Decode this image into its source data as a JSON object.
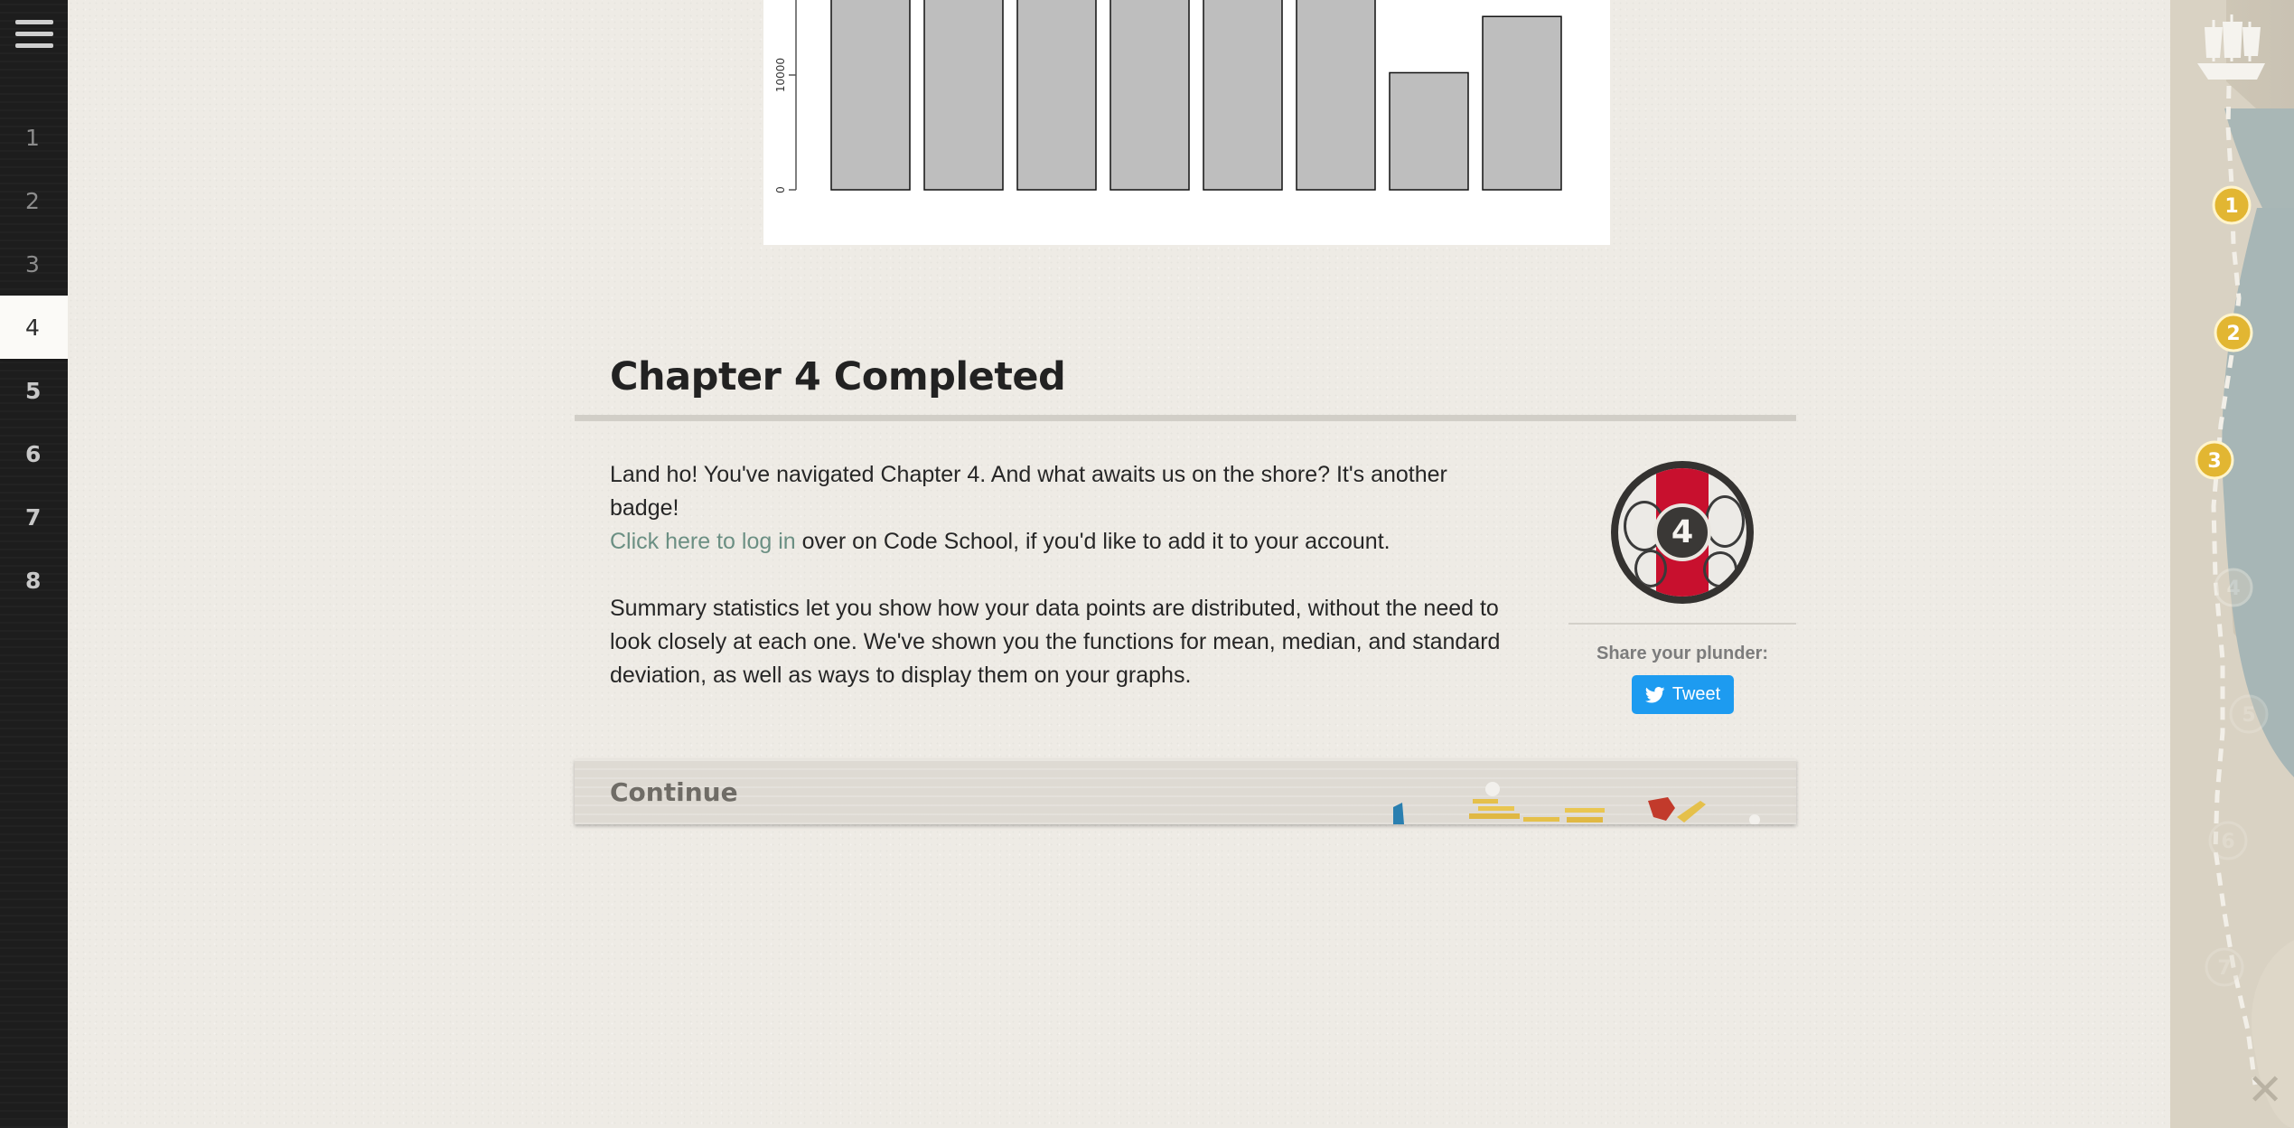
{
  "sidebar": {
    "chapters": [
      {
        "label": "1",
        "state": "done"
      },
      {
        "label": "2",
        "state": "done"
      },
      {
        "label": "3",
        "state": "done"
      },
      {
        "label": "4",
        "state": "active"
      },
      {
        "label": "5",
        "state": "upcoming"
      },
      {
        "label": "6",
        "state": "upcoming"
      },
      {
        "label": "7",
        "state": "upcoming"
      },
      {
        "label": "8",
        "state": "upcoming"
      }
    ]
  },
  "chart_data": {
    "type": "bar",
    "y_ticks": [
      "0",
      "10000"
    ],
    "ylim": [
      0,
      20000
    ],
    "values": [
      24000,
      24000,
      24000,
      24000,
      24000,
      24000,
      10200,
      15100
    ],
    "bar_color": "#bebebe"
  },
  "completion": {
    "title": "Chapter 4 Completed",
    "paragraph1_before": "Land ho! You've navigated Chapter 4. And what awaits us on the shore? It's another badge!",
    "login_link": "Click here to log in",
    "paragraph1_after": " over on Code School, if you'd like to add it to your account.",
    "paragraph2": "Summary statistics let you show how your data points are distributed, without the need to look closely at each one. We've shown you the functions for mean, median, and standard deviation, as well as ways to display them on your graphs.",
    "badge_number": "4",
    "share_label": "Share your plunder:",
    "tweet_label": "Tweet"
  },
  "continue_bar": {
    "label": "Continue"
  },
  "voyage_map": {
    "markers": [
      {
        "label": "1",
        "state": "reached"
      },
      {
        "label": "2",
        "state": "reached"
      },
      {
        "label": "3",
        "state": "reached"
      },
      {
        "label": "4",
        "state": "faded"
      },
      {
        "label": "5",
        "state": "faded"
      },
      {
        "label": "6",
        "state": "faded"
      },
      {
        "label": "7",
        "state": "faded"
      }
    ],
    "gold_color": "#e2b632"
  }
}
